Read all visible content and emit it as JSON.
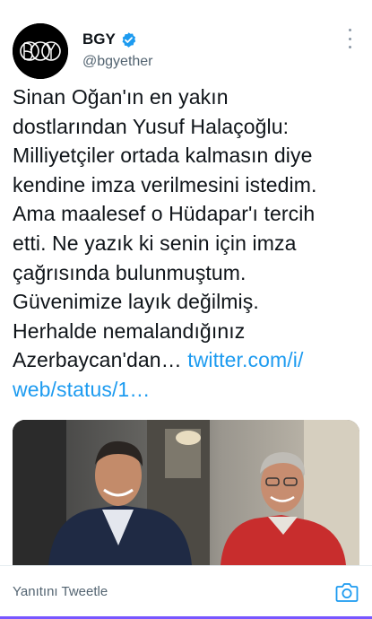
{
  "user": {
    "display_name": "BGY",
    "handle": "@bgyether",
    "verified_icon": "verified-badge-icon",
    "avatar_text": "BGY"
  },
  "tweet": {
    "lines": [
      "Sinan Oğan'ın en yakın",
      "dostlarından Yusuf Halaçoğlu:",
      "Milliyetçiler ortada kalmasın diye",
      "kendine imza verilmesini istedim.",
      "Ama maalesef o Hüdapar'ı tercih",
      "etti. Ne yazık ki senin için imza",
      "çağrısında bulunmuştum.",
      "Güvenimize layık değilmiş.",
      "Herhalde nemalandığınız"
    ],
    "line10_text": "Azerbaycan'dan…",
    "link_part1": "twitter.com/i/",
    "link_part2": "web/status/1…"
  },
  "reply": {
    "placeholder": "Yanıtını Tweetle",
    "camera_icon": "camera-icon"
  },
  "colors": {
    "link": "#1d9bf0",
    "secondary_text": "#536471",
    "accent_bar": "#7856ff"
  }
}
